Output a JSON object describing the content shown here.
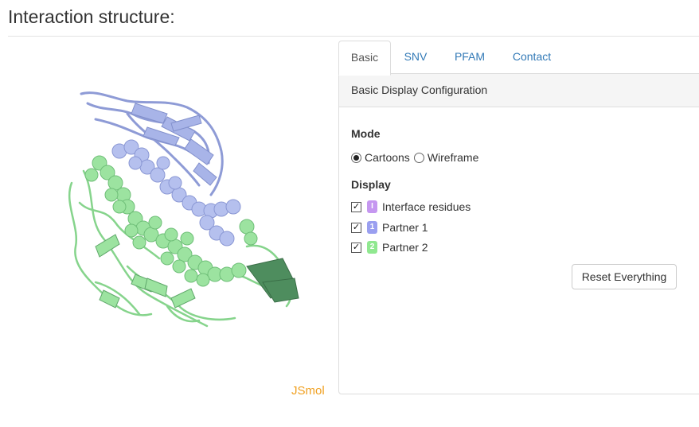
{
  "page": {
    "title": "Interaction structure:"
  },
  "viewer": {
    "label": "JSmol",
    "colors": {
      "partner1": "#a8b4e8",
      "partner2": "#9ce3a0",
      "partner2_dark": "#4e8d5e"
    }
  },
  "tabs": [
    {
      "label": "Basic",
      "active": true
    },
    {
      "label": "SNV",
      "active": false
    },
    {
      "label": "PFAM",
      "active": false
    },
    {
      "label": "Contact",
      "active": false
    }
  ],
  "panel": {
    "heading": "Basic Display Configuration",
    "mode": {
      "label": "Mode",
      "options": [
        {
          "label": "Cartoons",
          "checked": true
        },
        {
          "label": "Wireframe",
          "checked": false
        }
      ]
    },
    "display": {
      "label": "Display",
      "items": [
        {
          "badge": "I",
          "badge_color": "#c597f0",
          "label": "Interface residues",
          "checked": true
        },
        {
          "badge": "1",
          "badge_color": "#9a9ff0",
          "label": "Partner 1",
          "checked": true
        },
        {
          "badge": "2",
          "badge_color": "#90e890",
          "label": "Partner 2",
          "checked": true
        }
      ]
    },
    "reset_label": "Reset Everything"
  }
}
